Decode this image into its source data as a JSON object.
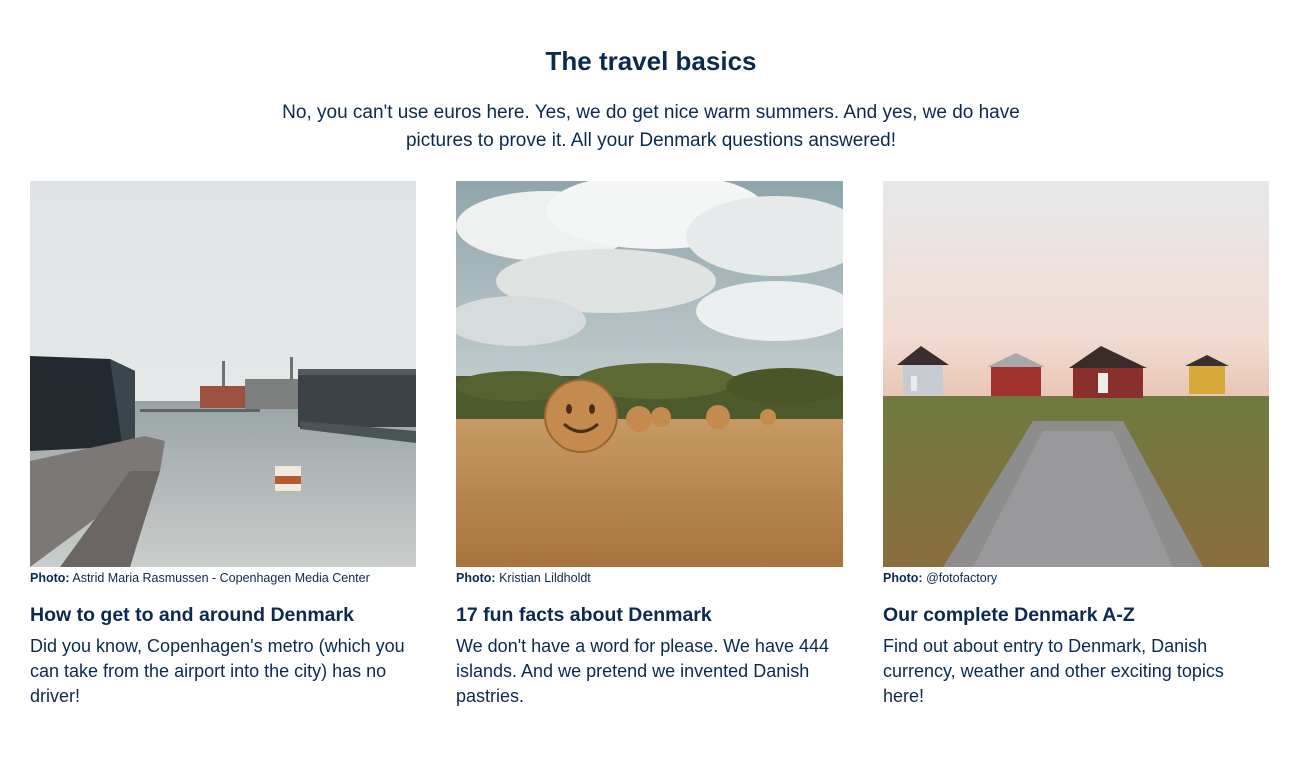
{
  "section": {
    "title": "The travel basics",
    "intro": "No, you can't use euros here. Yes, we do get nice warm summers. And yes, we do have pictures to prove it. All your Denmark questions answered!"
  },
  "cards": [
    {
      "photo_label": "Photo:",
      "photo_credit": "Astrid Maria Rasmussen - Copenhagen Media Center",
      "title": "How to get to and around Denmark",
      "text": "Did you know, Copenhagen's metro (which you can take from the airport into the city) has no driver!"
    },
    {
      "photo_label": "Photo:",
      "photo_credit": "Kristian Lildholdt",
      "title": "17 fun facts about Denmark",
      "text": "We don't have a word for please. We have 444 islands. And we pretend we invented Danish pastries."
    },
    {
      "photo_label": "Photo:",
      "photo_credit": "@fotofactory",
      "title": "Our complete Denmark A-Z",
      "text": "Find out about entry to Denmark, Danish currency, weather and other exciting topics here!"
    }
  ],
  "colors": {
    "text": "#0b2a4e",
    "background": "#ffffff"
  }
}
